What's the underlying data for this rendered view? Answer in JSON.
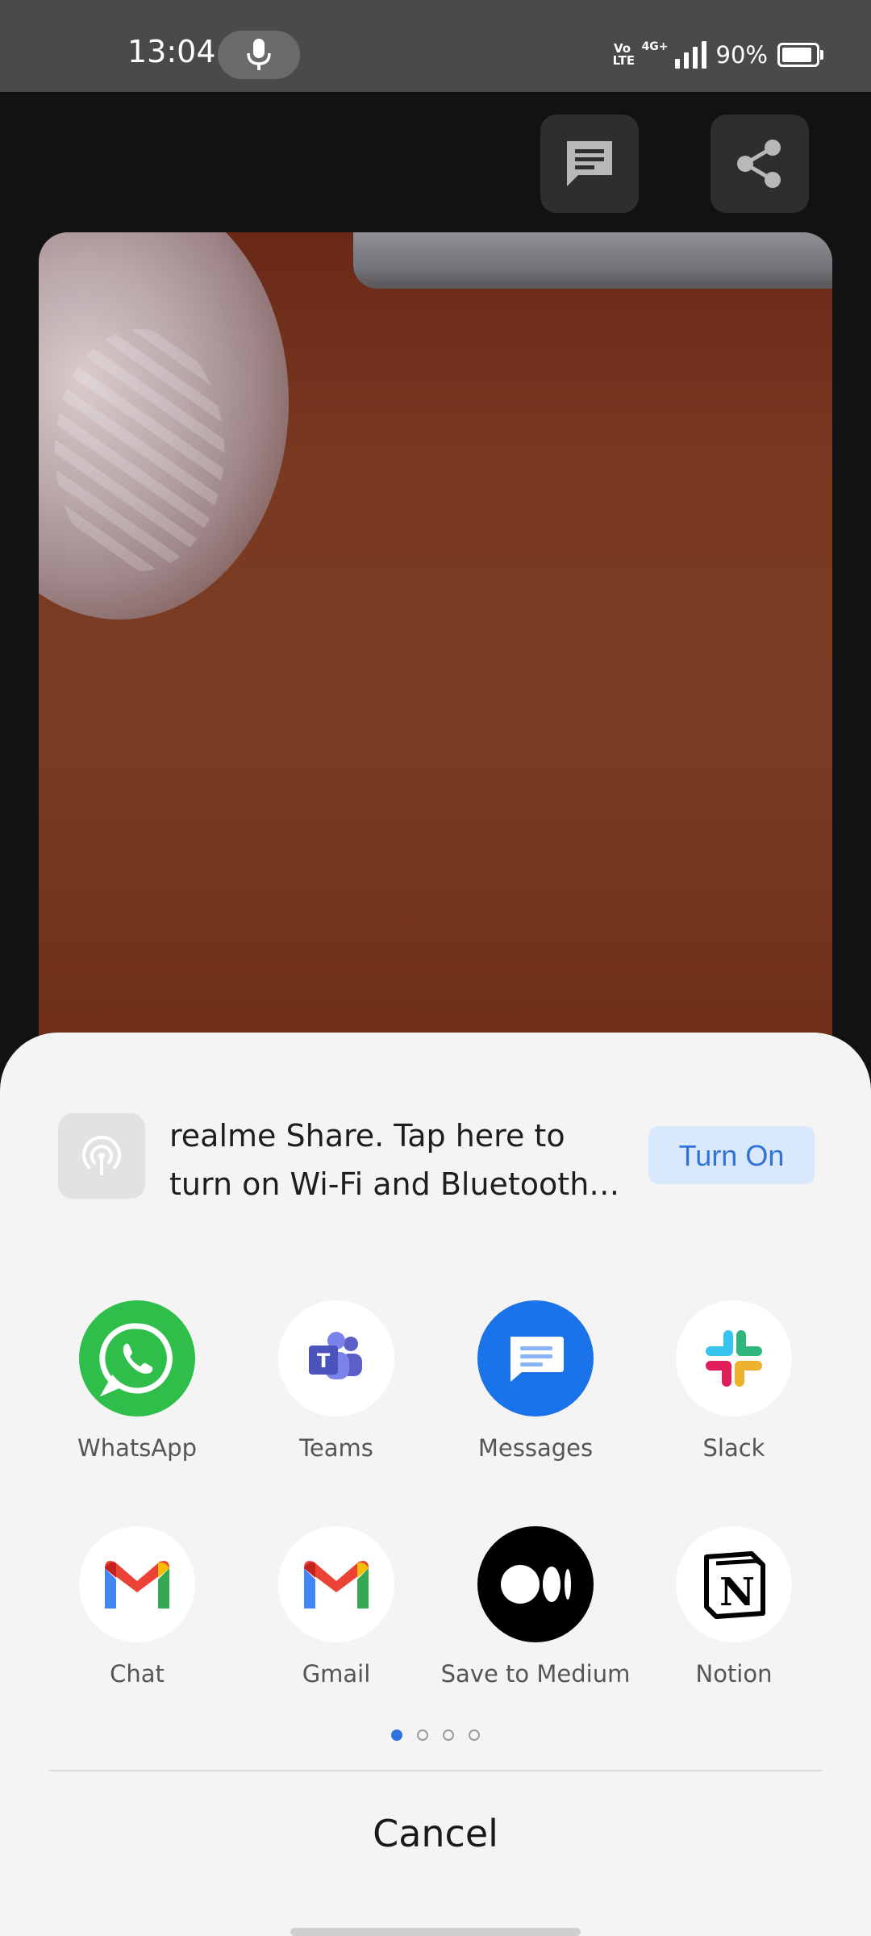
{
  "status_bar": {
    "time": "13:04",
    "volte": "Vo LTE",
    "network": "4G+",
    "battery_percent": "90%",
    "battery_level": 0.9
  },
  "toolbar": {
    "comment_icon": "comment-icon",
    "share_icon": "share-icon"
  },
  "realme_share": {
    "text": "realme Share. Tap here to turn on Wi-Fi and Bluetooth…",
    "button_label": "Turn On",
    "icon": "airdrop-icon"
  },
  "apps": [
    {
      "label": "WhatsApp",
      "icon": "whatsapp-icon"
    },
    {
      "label": "Teams",
      "icon": "teams-icon"
    },
    {
      "label": "Messages",
      "icon": "messages-icon"
    },
    {
      "label": "Slack",
      "icon": "slack-icon"
    },
    {
      "label": "Chat",
      "icon": "chat-icon"
    },
    {
      "label": "Gmail",
      "icon": "gmail-icon"
    },
    {
      "label": "Save to Medium",
      "icon": "medium-icon"
    },
    {
      "label": "Notion",
      "icon": "notion-icon"
    }
  ],
  "pager": {
    "pages": 4,
    "current": 1
  },
  "cancel_label": "Cancel",
  "colors": {
    "accent": "#2e74e0",
    "turn_on_bg": "#d9e8fb",
    "sheet_bg": "#f4f4f4"
  }
}
